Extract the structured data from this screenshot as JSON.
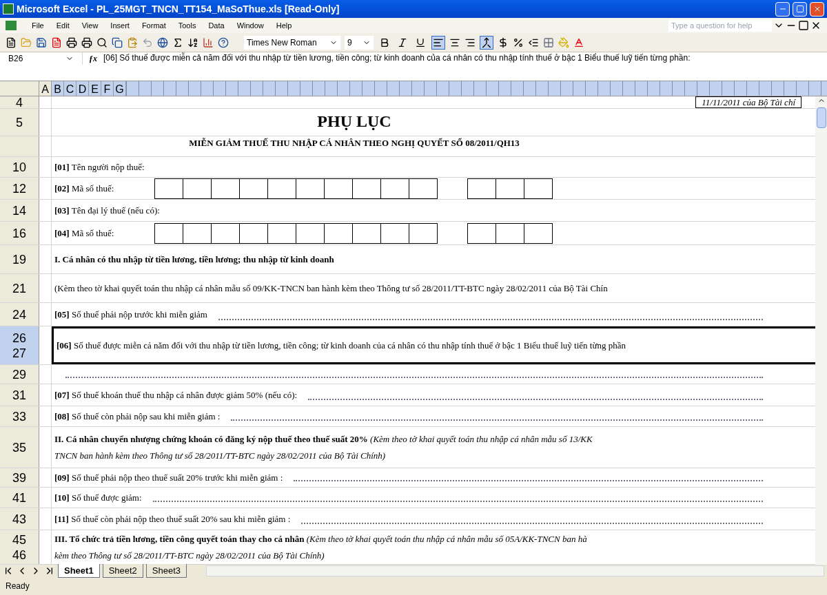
{
  "window": {
    "title": "Microsoft Excel - PL_25MGT_TNCN_TT154_MaSoThue.xls  [Read-Only]"
  },
  "menu": [
    "File",
    "Edit",
    "View",
    "Insert",
    "Format",
    "Tools",
    "Data",
    "Window",
    "Help"
  ],
  "help_search": {
    "placeholder": "Type a question for help"
  },
  "toolbar": {
    "font": "Times New Roman",
    "size": "9",
    "bold": false,
    "italic": false,
    "underline": false,
    "align_left": true,
    "merge": true
  },
  "formula_bar": {
    "cell": "B26",
    "fx_label": "ƒx",
    "content": "[06] Số thuế được miễn cả năm đối với thu nhập từ tiền lương, tiền công; từ kinh doanh của cá nhân có thu nhập tính thuế ở bậc 1 Biểu thuế luỹ tiến từng phần:"
  },
  "columns": [
    {
      "label": "A",
      "selected": false
    },
    {
      "label": "B",
      "selected": true
    },
    {
      "label": "C",
      "selected": true
    },
    {
      "label": "D",
      "selected": true
    },
    {
      "label": "E",
      "selected": true
    },
    {
      "label": "F",
      "selected": true
    },
    {
      "label": "G",
      "selected": true
    }
  ],
  "rows": [
    {
      "numbers": [
        "4"
      ],
      "kind": "note",
      "text": "11/11/2011 của Bộ Tài chí",
      "selected": false
    },
    {
      "numbers": [
        "5"
      ],
      "kind": "title",
      "text": "PHỤ LỤC",
      "selected": false
    },
    {
      "numbers": [],
      "kind": "subtitle",
      "text": "MIỄN GIẢM THUẾ THU NHẬP CÁ NHÂN  THEO NGHỊ QUYẾT SỐ 08/2011/QH13",
      "selected": false
    },
    {
      "numbers": [
        "10"
      ],
      "kind": "label",
      "text": "**[01]** Tên người nộp thuế:",
      "selected": false
    },
    {
      "numbers": [
        "12"
      ],
      "kind": "boxes",
      "text": "**[02]** Mã số thuế:",
      "selected": false
    },
    {
      "numbers": [
        "14"
      ],
      "kind": "label",
      "text": "**[03]** Tên đại lý thuế (nếu có):",
      "selected": false
    },
    {
      "numbers": [
        "16"
      ],
      "kind": "boxes",
      "text": "**[04]** Mã số thuế:",
      "selected": false
    },
    {
      "numbers": [
        "19"
      ],
      "kind": "heading",
      "text": "I. Cá nhân có thu nhập từ tiền lương, tiền lương; thu nhập từ kinh doanh",
      "selected": false
    },
    {
      "numbers": [
        "21"
      ],
      "kind": "label",
      "text": "(Kèm theo tờ khai quyết toán thu nhập cá nhân mẫu số 09/KK-TNCN ban hành kèm theo Thông tư số 28/2011/TT-BTC ngày 28/02/2011 của Bộ Tài Chín",
      "selected": false
    },
    {
      "numbers": [
        "24"
      ],
      "kind": "fill",
      "text": "**[05]** Số thuế phải nộp trước khi miễn giảm",
      "selected": false
    },
    {
      "numbers": [
        "26",
        "27"
      ],
      "kind": "label",
      "text": "**[06]** Số thuế được miễn cả năm đối với thu nhập từ tiền lương, tiền công; từ kinh doanh của cá nhân có thu nhập tính thuế ở bậc 1 Biểu thuế luỹ tiến từng phần",
      "selected": true
    },
    {
      "numbers": [
        "29"
      ],
      "kind": "fill",
      "text": "",
      "selected": false
    },
    {
      "numbers": [
        "31"
      ],
      "kind": "fill",
      "text": "**[07]** Số thuế khoán thuế thu nhập cá nhân được giảm 50%  (nếu có):",
      "selected": false
    },
    {
      "numbers": [
        "33"
      ],
      "kind": "fill",
      "text": "**[08]** Số thuế còn phải nộp sau khi miễn giảm :",
      "selected": false
    },
    {
      "numbers": [
        "35"
      ],
      "kind": "section",
      "text": "**II. Cá nhân chuyển nhượng chứng khoán có đăng ký nộp thuế theo thuế suất 20%** *(Kèm theo tờ khai quyết toán thu nhập cá nhân mẫu số 13/KK*",
      "text2": "TNCN ban hành kèm theo Thông tư số 28/2011/TT-BTC ngày 28/02/2011 của Bộ Tài Chính)",
      "selected": false
    },
    {
      "numbers": [
        "39"
      ],
      "kind": "fill",
      "text": "**[09]** Số thuế phải nộp theo thuế suất 20% trước khi miễn giảm :",
      "selected": false
    },
    {
      "numbers": [
        "41"
      ],
      "kind": "fill",
      "text": "**[10]** Số thuế được giảm:",
      "selected": false
    },
    {
      "numbers": [
        "43"
      ],
      "kind": "fill",
      "text": "**[11]** Số thuế còn phải nộp theo thuế suất 20% sau khi miễn giảm :",
      "selected": false
    },
    {
      "numbers": [
        "45",
        "46"
      ],
      "kind": "section",
      "text": "**III. Tổ chức trả tiền lương, tiền công quyết toán thay cho cá nhân** *(Kèm theo tờ khai quyết toán thu nhập cá nhân mẫu số 05A/KK-TNCN ban hà*",
      "text2": "kèm theo Thông tư số 28/2011/TT-BTC ngày 28/02/2011 của Bộ Tài Chính)",
      "selected": false
    }
  ],
  "sheets": [
    {
      "label": "Sheet1",
      "selected": true
    },
    {
      "label": "Sheet2",
      "selected": false
    },
    {
      "label": "Sheet3",
      "selected": false
    }
  ],
  "status_bar": "Ready"
}
